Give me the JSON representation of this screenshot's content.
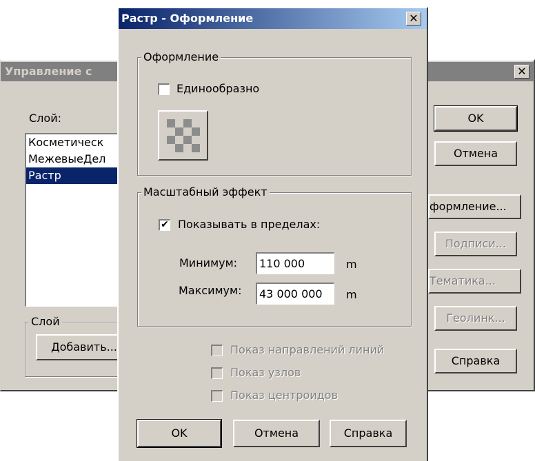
{
  "background_dialog": {
    "title": "Управление с",
    "close_glyph": "✕",
    "layer_label": "Слой:",
    "layers": [
      {
        "name": "Косметическ",
        "selected": false
      },
      {
        "name": "МежевыеДел",
        "selected": false
      },
      {
        "name": "Растр",
        "selected": true
      }
    ],
    "layer_group_label": "Слой",
    "add_button": "Добавить...",
    "buttons": {
      "ok": "OK",
      "cancel": "Отмена",
      "style": "формление...",
      "labels": "Подписи...",
      "thematic": "Тематика...",
      "geolink": "Геолинк...",
      "help": "Справка"
    }
  },
  "dialog": {
    "title": "Растр - Оформление",
    "close_glyph": "✕",
    "style_group": {
      "label": "Оформление",
      "uniform_label": "Единообразно",
      "uniform_checked": false
    },
    "scale_group": {
      "label": "Масштабный эффект",
      "show_range_label": "Показывать в пределах:",
      "show_range_checked": true,
      "min_label": "Минимум:",
      "min_value": "110 000",
      "min_unit": "m",
      "max_label": "Максимум:",
      "max_value": "43 000 000",
      "max_unit": "m"
    },
    "options": {
      "line_direction": "Показ направлений линий",
      "nodes": "Показ узлов",
      "centroids": "Показ центроидов"
    },
    "checkmark": "✔",
    "buttons": {
      "ok": "OK",
      "cancel": "Отмена",
      "help": "Справка"
    }
  },
  "colors": {
    "face": "#d4d0c8",
    "selection": "#0a246a",
    "title_active_start": "#0a246a",
    "title_active_end": "#a6caf0",
    "title_inactive": "#808080",
    "pattern": "#8c8c8c"
  }
}
